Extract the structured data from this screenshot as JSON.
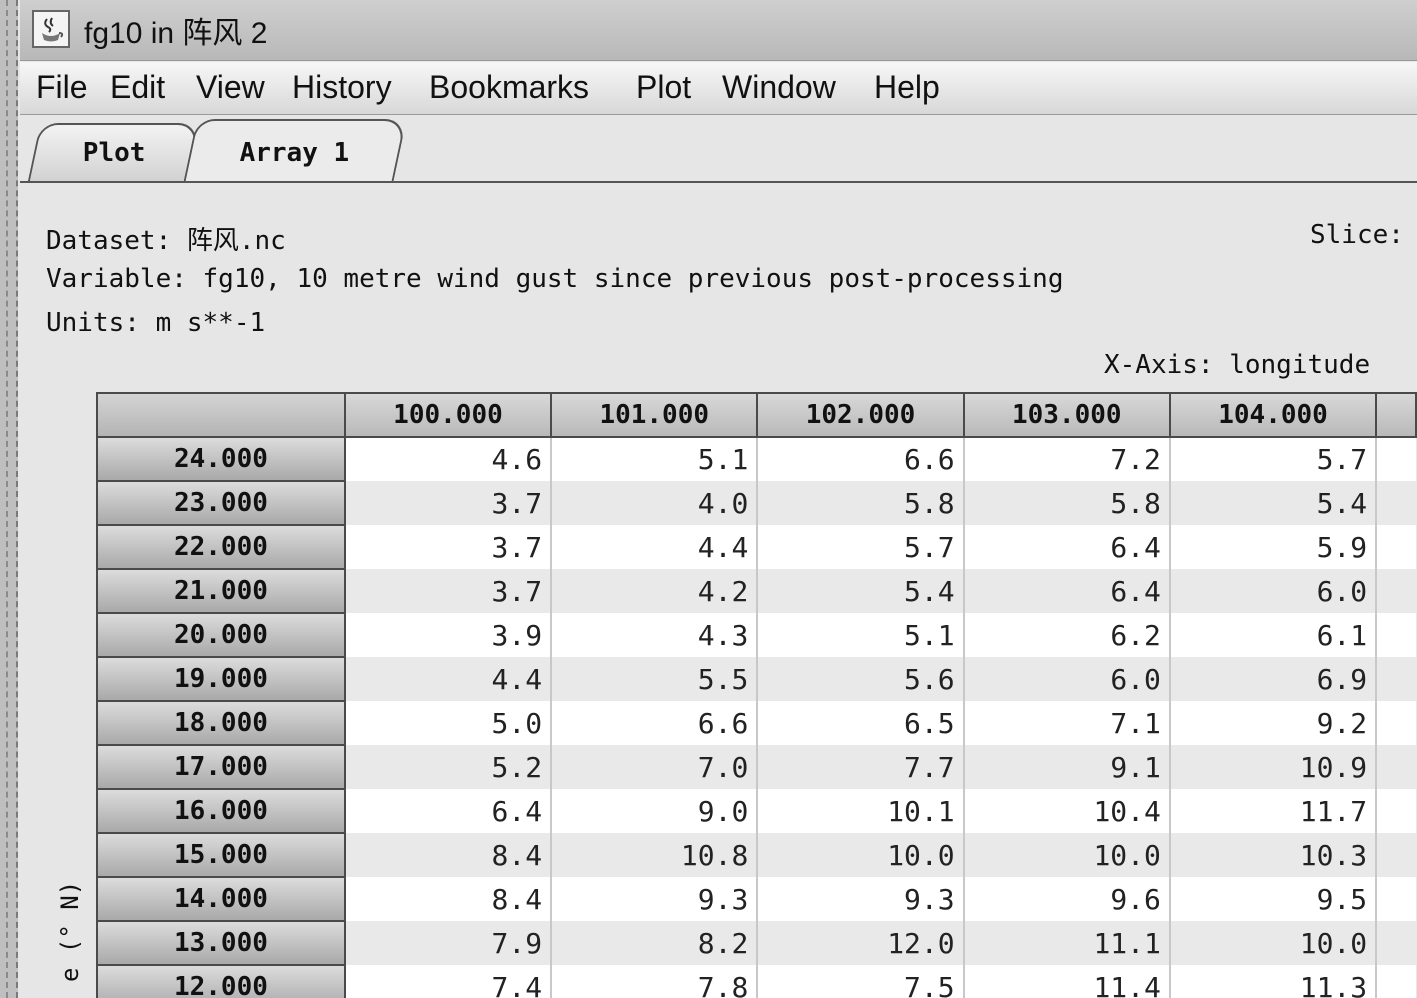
{
  "window": {
    "title": "fg10 in 阵风 2",
    "icon": "java-cup-icon"
  },
  "menu": [
    "File",
    "Edit",
    "View",
    "History",
    "Bookmarks",
    "Plot",
    "Window",
    "Help"
  ],
  "tabs": [
    {
      "label": "Plot",
      "active": false
    },
    {
      "label": "Array 1",
      "active": true
    }
  ],
  "info": {
    "dataset": "Dataset: 阵风.nc",
    "variable": "Variable: fg10, 10 metre wind gust since previous post-processing",
    "units": "Units: m s**-1",
    "slice": "Slice:",
    "x_axis": "X-Axis: longitude",
    "y_axis_partial": "e (° N)"
  },
  "grid": {
    "columns": [
      "100.000",
      "101.000",
      "102.000",
      "103.000",
      "104.000"
    ],
    "rows": [
      {
        "label": "24.000",
        "values": [
          "4.6",
          "5.1",
          "6.6",
          "7.2",
          "5.7"
        ]
      },
      {
        "label": "23.000",
        "values": [
          "3.7",
          "4.0",
          "5.8",
          "5.8",
          "5.4"
        ]
      },
      {
        "label": "22.000",
        "values": [
          "3.7",
          "4.4",
          "5.7",
          "6.4",
          "5.9"
        ]
      },
      {
        "label": "21.000",
        "values": [
          "3.7",
          "4.2",
          "5.4",
          "6.4",
          "6.0"
        ]
      },
      {
        "label": "20.000",
        "values": [
          "3.9",
          "4.3",
          "5.1",
          "6.2",
          "6.1"
        ]
      },
      {
        "label": "19.000",
        "values": [
          "4.4",
          "5.5",
          "5.6",
          "6.0",
          "6.9"
        ]
      },
      {
        "label": "18.000",
        "values": [
          "5.0",
          "6.6",
          "6.5",
          "7.1",
          "9.2"
        ]
      },
      {
        "label": "17.000",
        "values": [
          "5.2",
          "7.0",
          "7.7",
          "9.1",
          "10.9"
        ]
      },
      {
        "label": "16.000",
        "values": [
          "6.4",
          "9.0",
          "10.1",
          "10.4",
          "11.7"
        ]
      },
      {
        "label": "15.000",
        "values": [
          "8.4",
          "10.8",
          "10.0",
          "10.0",
          "10.3"
        ]
      },
      {
        "label": "14.000",
        "values": [
          "8.4",
          "9.3",
          "9.3",
          "9.6",
          "9.5"
        ]
      },
      {
        "label": "13.000",
        "values": [
          "7.9",
          "8.2",
          "12.0",
          "11.1",
          "10.0"
        ]
      },
      {
        "label": "12.000",
        "values": [
          "7.4",
          "7.8",
          "7.5",
          "11.4",
          "11.3"
        ]
      }
    ]
  }
}
